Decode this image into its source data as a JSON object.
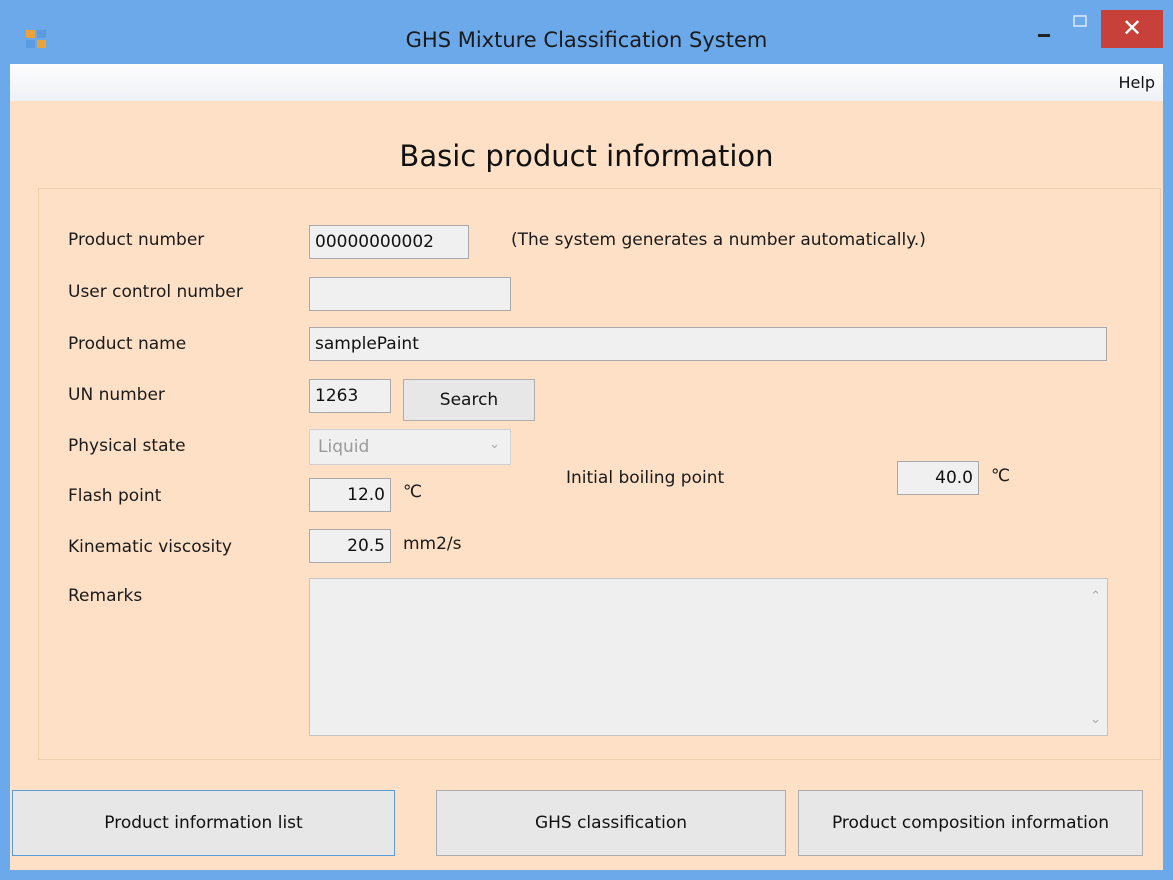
{
  "window": {
    "title": "GHS Mixture Classification System",
    "controls": {
      "minimize": "–",
      "maximize": "□",
      "close": "✕"
    },
    "icon": "app-icon"
  },
  "menu": {
    "help": "Help"
  },
  "form": {
    "heading": "Basic product information",
    "product_number": {
      "label": "Product number",
      "value": "00000000002",
      "note": "(The system generates a number automatically.)"
    },
    "user_control_number": {
      "label": "User control number",
      "value": ""
    },
    "product_name": {
      "label": "Product name",
      "value": "samplePaint"
    },
    "un_number": {
      "label": "UN number",
      "value": "1263",
      "search_label": "Search"
    },
    "physical_state": {
      "label": "Physical state",
      "value": "Liquid"
    },
    "flash_point": {
      "label": "Flash point",
      "value": "12.0",
      "unit": "℃"
    },
    "initial_boiling_point": {
      "label": "Initial boiling point",
      "value": "40.0",
      "unit": "℃"
    },
    "kinematic_viscosity": {
      "label": "Kinematic viscosity",
      "value": "20.5",
      "unit": "mm2/s"
    },
    "remarks": {
      "label": "Remarks",
      "value": ""
    }
  },
  "buttons": {
    "product_information_list": "Product information list",
    "ghs_classification": "GHS classification",
    "product_composition_information": "Product composition information"
  },
  "colors": {
    "titlebar": "#6ba9ea",
    "client_background": "#fde0c6",
    "close_button": "#c7403a"
  }
}
